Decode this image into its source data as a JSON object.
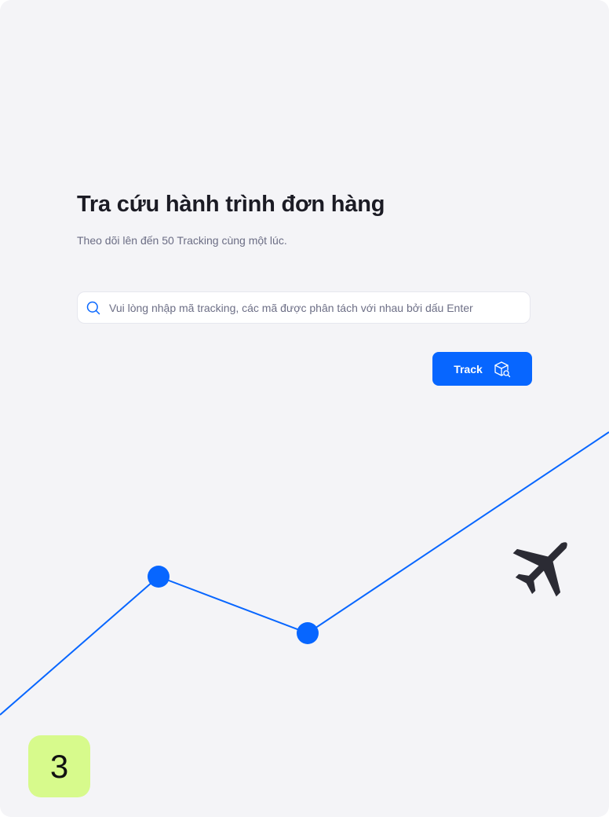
{
  "header": {
    "title": "Tra cứu hành trình đơn hàng",
    "subtitle": "Theo dõi lên đến 50 Tracking cùng một lúc."
  },
  "search": {
    "placeholder": "Vui lòng nhập mã tracking, các mã được phân tách với nhau bởi dấu Enter",
    "value": "",
    "icon": "search-icon"
  },
  "actions": {
    "track_label": "Track",
    "track_icon": "box-search-icon"
  },
  "illustration": {
    "line_color": "#0766ff",
    "plane_color": "#2b2b34",
    "plane_icon": "airplane-icon"
  },
  "badge": {
    "step": "3",
    "color": "#d7fa8c"
  },
  "colors": {
    "accent": "#0766ff",
    "background": "#f4f4f7"
  }
}
